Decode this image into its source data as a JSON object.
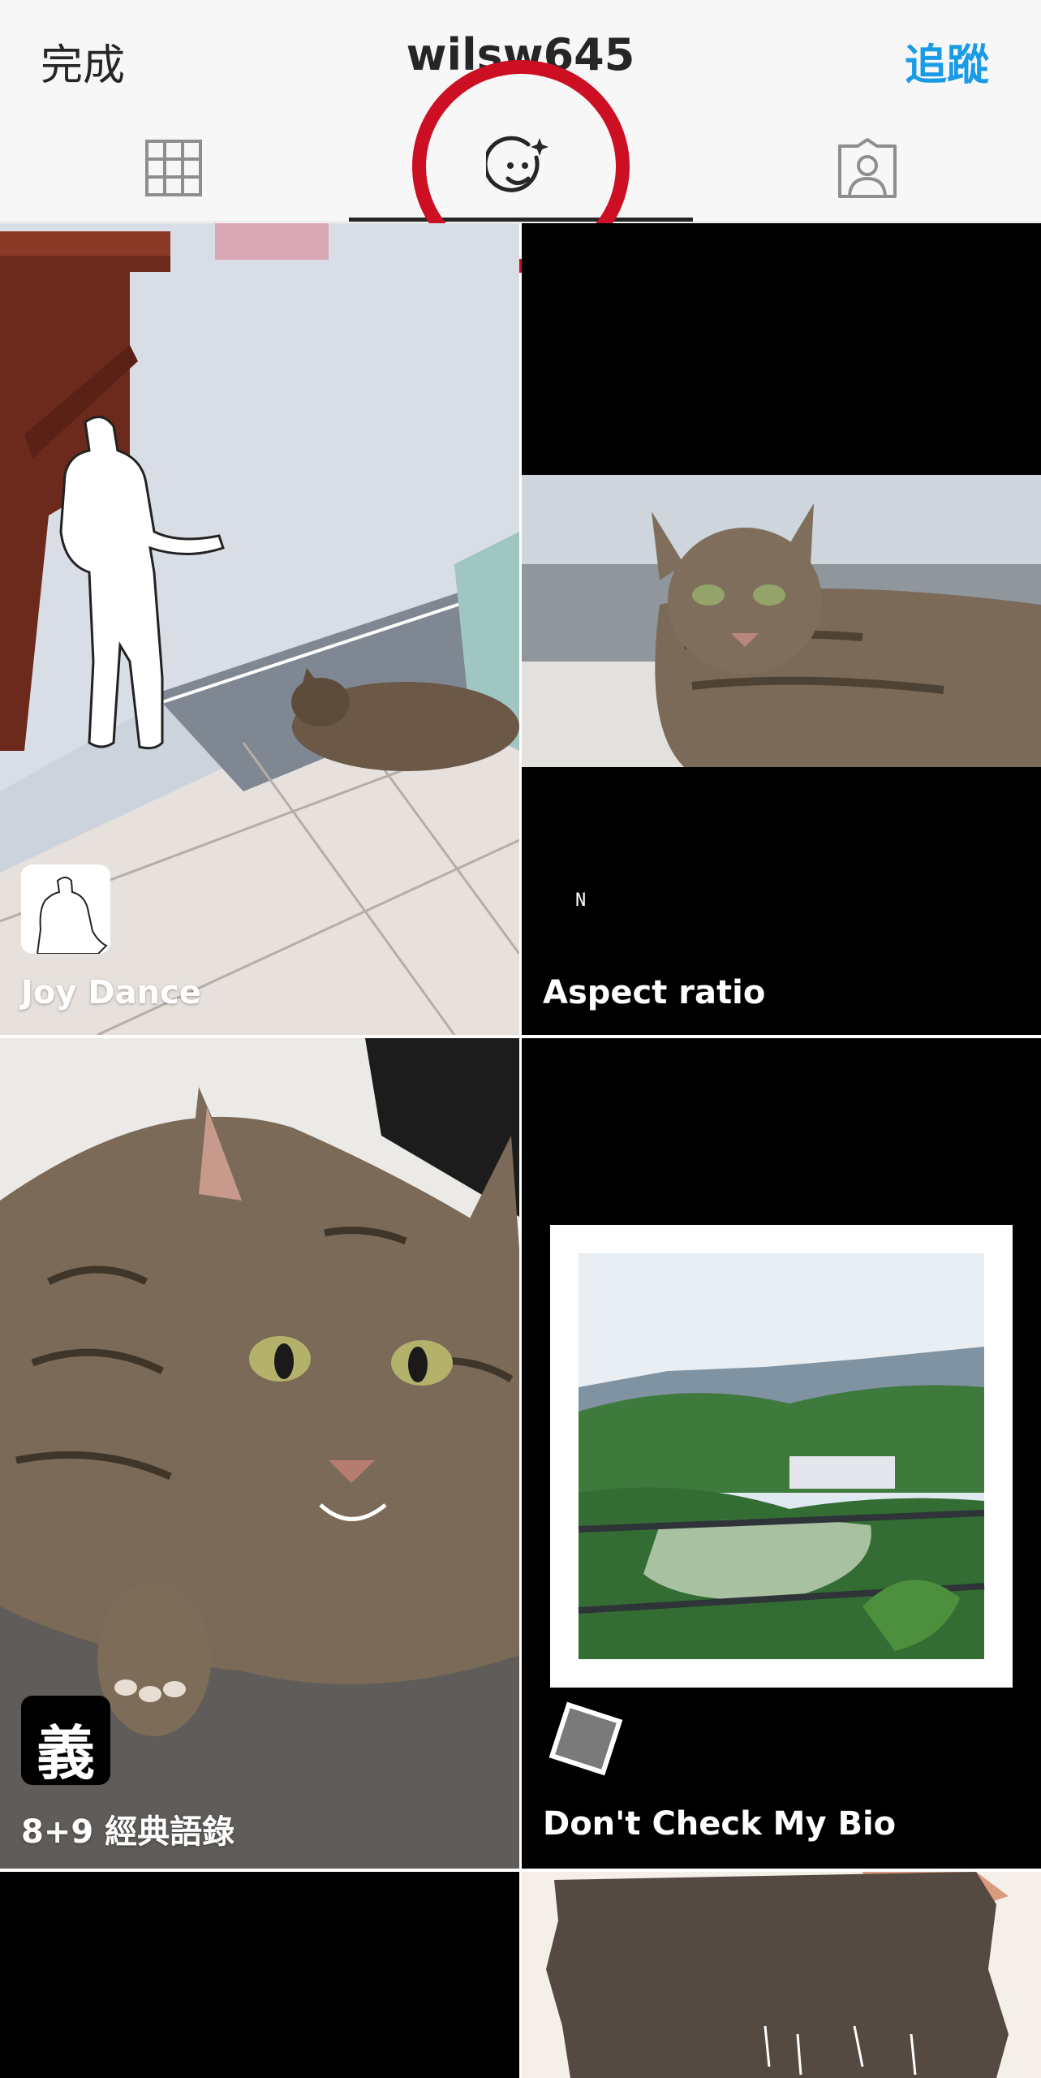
{
  "header": {
    "done_label": "完成",
    "username": "wilsw645",
    "follow_label": "追蹤"
  },
  "tabs": [
    {
      "name": "grid",
      "icon": "grid-icon",
      "active": false
    },
    {
      "name": "effects",
      "icon": "face-sparkle-icon",
      "active": true
    },
    {
      "name": "tagged",
      "icon": "tagged-person-icon",
      "active": false
    }
  ],
  "colors": {
    "accent_blue": "#1a9be6",
    "annotation_red": "#cc0f23",
    "text_dark": "#262626"
  },
  "effects": [
    {
      "name": "Joy Dance",
      "badge_icon": "dancer-silhouette-icon"
    },
    {
      "name": "Aspect ratio",
      "badge_icon": "small-n-glyph-icon",
      "badge_glyph": "N"
    },
    {
      "name": "8+9 經典語錄",
      "badge_icon": "calligraphy-yi-icon",
      "badge_glyph": "義"
    },
    {
      "name": "Don't Check My Bio",
      "badge_icon": "tilted-square-icon"
    }
  ]
}
